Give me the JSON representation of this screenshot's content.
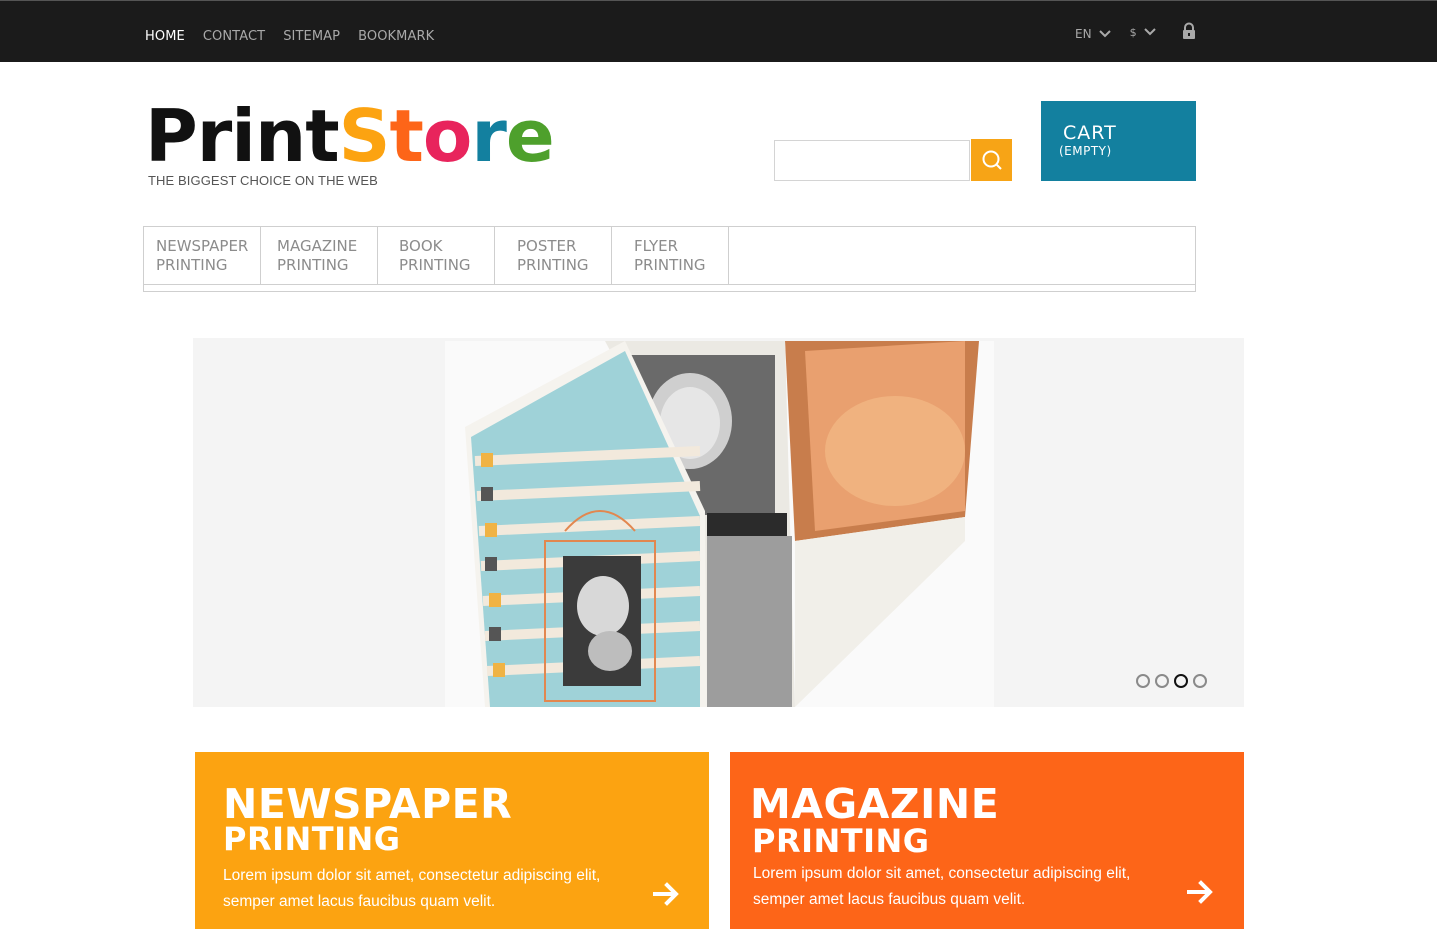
{
  "topbar": {
    "nav": [
      "HOME",
      "CONTACT",
      "SITEMAP",
      "BOOKMARK"
    ],
    "language": "EN",
    "currency": "$"
  },
  "header": {
    "logo_part1": "Print",
    "logo_part2_letters": [
      "S",
      "t",
      "o",
      "r",
      "e"
    ],
    "logo_colors": [
      "#fca311",
      "#fd6518",
      "#e8245c",
      "#13809f",
      "#4ea02c"
    ],
    "tagline": "THE BIGGEST CHOICE ON THE WEB",
    "search_placeholder": "",
    "cart_title": "CART",
    "cart_status": "(EMPTY)"
  },
  "menu": {
    "items": [
      {
        "label": "NEWSPAPER\nPRINTING"
      },
      {
        "label": "MAGAZINE\nPRINTING"
      },
      {
        "label": "BOOK\nPRINTING"
      },
      {
        "label": "POSTER\nPRINTING"
      },
      {
        "label": "FLYER\nPRINTING"
      }
    ]
  },
  "slider": {
    "dot_count": 4,
    "active_dot": 3
  },
  "promos": [
    {
      "title": "NEWSPAPER",
      "subtitle": "PRINTING",
      "text": "Lorem ipsum dolor sit amet, consectetur adipiscing elit, semper amet lacus faucibus quam velit.",
      "color": "#fca311"
    },
    {
      "title": "MAGAZINE",
      "subtitle": "PRINTING",
      "text": "Lorem ipsum dolor sit amet, consectetur adipiscing elit, semper amet lacus faucibus quam velit.",
      "color": "#fd6518"
    }
  ]
}
